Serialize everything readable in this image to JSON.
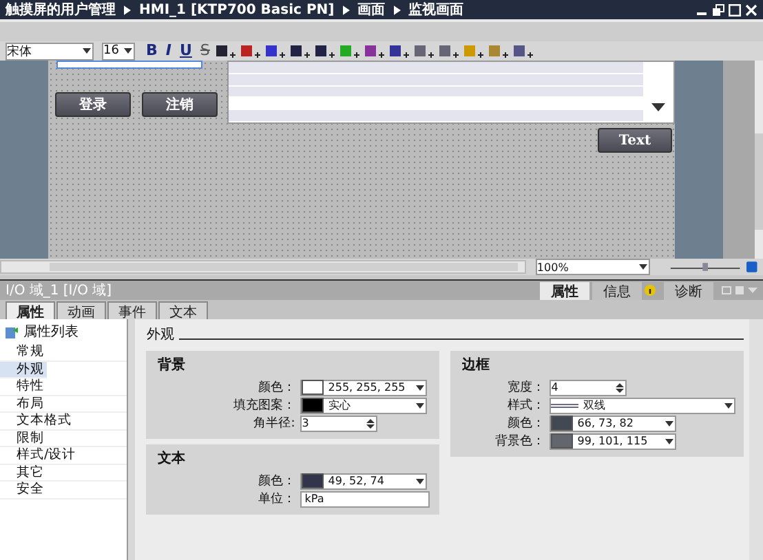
{
  "title_bar": {
    "breadcrumb": [
      "触摸屏的用户管理",
      "HMI_1 [KTP700 Basic PN]",
      "画面",
      "监视画面"
    ]
  },
  "toolbar": {
    "font": "宋体",
    "font_size": "16",
    "style_buttons": [
      "B",
      "I",
      "U",
      "S"
    ]
  },
  "canvas": {
    "buttons": [
      {
        "label": "登录"
      },
      {
        "label": "注销"
      },
      {
        "label": "Text"
      }
    ]
  },
  "zoom": {
    "value": "100%",
    "level": 0.5
  },
  "inspector": {
    "object_title": "I/O 域_1 [I/O 域]",
    "panel_tabs": [
      {
        "label": "属性",
        "selected": true
      },
      {
        "label": "信息",
        "selected": false
      },
      {
        "label": "诊断",
        "selected": false
      }
    ],
    "tabs": [
      {
        "label": "属性",
        "selected": true
      },
      {
        "label": "动画",
        "selected": false
      },
      {
        "label": "事件",
        "selected": false
      },
      {
        "label": "文本",
        "selected": false
      }
    ],
    "property_list": {
      "title": "属性列表",
      "items": [
        {
          "label": "常规",
          "selected": false
        },
        {
          "label": "外观",
          "selected": true
        },
        {
          "label": "特性",
          "selected": false
        },
        {
          "label": "布局",
          "selected": false
        },
        {
          "label": "文本格式",
          "selected": false
        },
        {
          "label": "限制",
          "selected": false
        },
        {
          "label": "样式/设计",
          "selected": false
        },
        {
          "label": "其它",
          "selected": false
        },
        {
          "label": "安全",
          "selected": false
        }
      ]
    },
    "section": "外观",
    "group_columns": [
      [
        {
          "title": "背景",
          "rows": [
            {
              "kind": "color",
              "label": "颜色：",
              "value": "255, 255, 255",
              "color": "#ffffff"
            },
            {
              "kind": "pattern",
              "label": "填充图案：",
              "value": "实心",
              "color": "#000000"
            },
            {
              "kind": "spin",
              "label": "角半径:",
              "value": "3"
            }
          ]
        },
        {
          "title": "文本",
          "rows": [
            {
              "kind": "color",
              "label": "颜色：",
              "value": "49, 52, 74",
              "color": "#31344a"
            },
            {
              "kind": "text",
              "label": "单位：",
              "value": "kPa"
            }
          ]
        }
      ],
      [
        {
          "title": "边框",
          "rows": [
            {
              "kind": "spin",
              "label": "宽度：",
              "value": "4"
            },
            {
              "kind": "line",
              "label": "样式：",
              "value": "双线"
            },
            {
              "kind": "color",
              "label": "颜色：",
              "value": "66, 73, 82",
              "color": "#424952"
            },
            {
              "kind": "color",
              "label": "背景色：",
              "value": "99, 101, 115",
              "color": "#63656f"
            }
          ]
        }
      ]
    ]
  }
}
